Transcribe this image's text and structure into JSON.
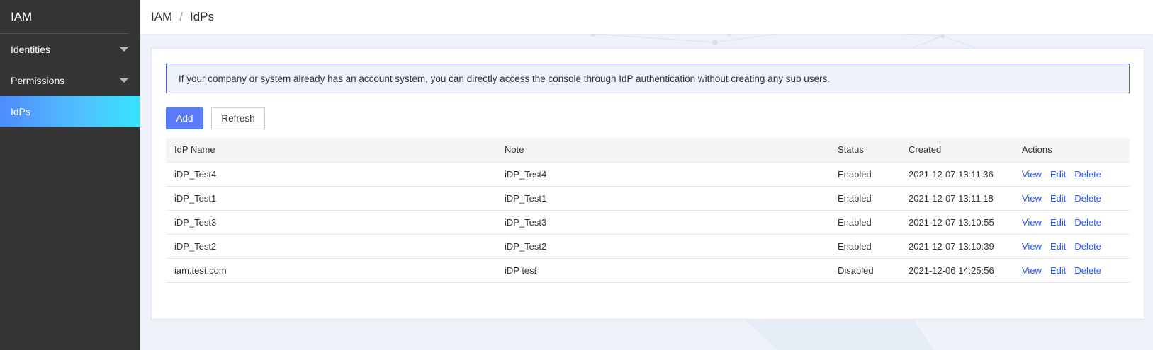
{
  "sidebar": {
    "brand": "IAM",
    "items": [
      {
        "label": "Identities",
        "expandable": true,
        "active": false
      },
      {
        "label": "Permissions",
        "expandable": true,
        "active": false
      },
      {
        "label": "IdPs",
        "expandable": false,
        "active": true
      }
    ]
  },
  "header": {
    "breadcrumb": [
      "IAM",
      "IdPs"
    ],
    "separator": "/"
  },
  "notice": "If your company or system already has an account system, you can directly access the console through IdP authentication without creating any sub users.",
  "toolbar": {
    "add_label": "Add",
    "refresh_label": "Refresh"
  },
  "table": {
    "columns": [
      "IdP Name",
      "Note",
      "Status",
      "Created",
      "Actions"
    ],
    "rows": [
      {
        "name": "iDP_Test4",
        "note": "iDP_Test4",
        "status": "Enabled",
        "created": "2021-12-07 13:11:36"
      },
      {
        "name": "iDP_Test1",
        "note": "iDP_Test1",
        "status": "Enabled",
        "created": "2021-12-07 13:11:18"
      },
      {
        "name": "iDP_Test3",
        "note": "iDP_Test3",
        "status": "Enabled",
        "created": "2021-12-07 13:10:55"
      },
      {
        "name": "iDP_Test2",
        "note": "iDP_Test2",
        "status": "Enabled",
        "created": "2021-12-07 13:10:39"
      },
      {
        "name": "iam.test.com",
        "note": "iDP test",
        "status": "Disabled",
        "created": "2021-12-06 14:25:56"
      }
    ],
    "actions": [
      "View",
      "Edit",
      "Delete"
    ]
  },
  "colors": {
    "sidebar_bg": "#353535",
    "active_gradient_start": "#4f8bff",
    "active_gradient_end": "#36e2ff",
    "primary_button": "#5b7cf6",
    "link": "#2e56e8",
    "notice_border": "#4c5ee0",
    "notice_bg": "#eef2fc"
  }
}
